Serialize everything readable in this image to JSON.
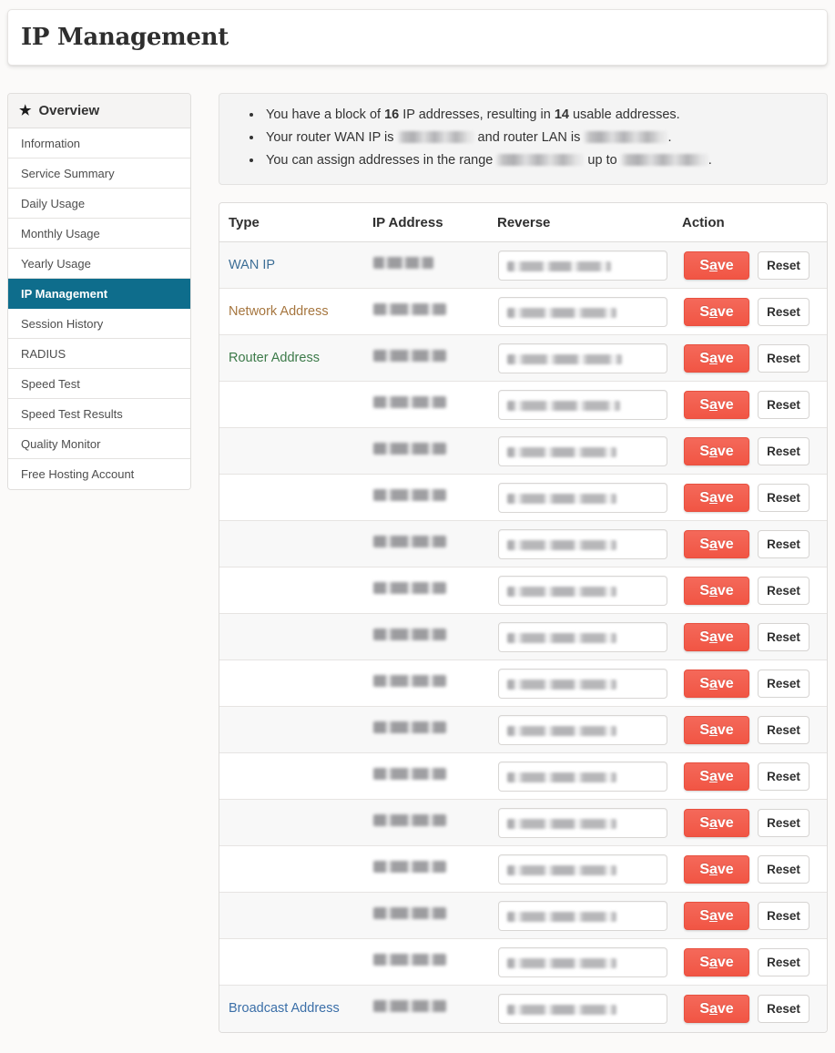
{
  "page": {
    "title": "IP Management"
  },
  "sidebar": {
    "header": {
      "label": "Overview",
      "icon": "star-icon"
    },
    "items": [
      {
        "label": "Information",
        "active": false
      },
      {
        "label": "Service Summary",
        "active": false
      },
      {
        "label": "Daily Usage",
        "active": false
      },
      {
        "label": "Monthly Usage",
        "active": false
      },
      {
        "label": "Yearly Usage",
        "active": false
      },
      {
        "label": "IP Management",
        "active": true
      },
      {
        "label": "Session History",
        "active": false
      },
      {
        "label": "RADIUS",
        "active": false
      },
      {
        "label": "Speed Test",
        "active": false
      },
      {
        "label": "Speed Test Results",
        "active": false
      },
      {
        "label": "Quality Monitor",
        "active": false
      },
      {
        "label": "Free Hosting Account",
        "active": false
      }
    ]
  },
  "info_panel": {
    "bullets": [
      {
        "parts": [
          {
            "type": "text",
            "value": "You have a block of "
          },
          {
            "type": "strong",
            "value": "16"
          },
          {
            "type": "text",
            "value": " IP addresses, resulting in "
          },
          {
            "type": "strong",
            "value": "14"
          },
          {
            "type": "text",
            "value": " usable addresses."
          }
        ]
      },
      {
        "parts": [
          {
            "type": "text",
            "value": "Your router WAN IP is "
          },
          {
            "type": "redacted",
            "value": "",
            "style": "r-wan"
          },
          {
            "type": "text",
            "value": " and router LAN is "
          },
          {
            "type": "redacted",
            "value": "",
            "style": "r-lan"
          },
          {
            "type": "text",
            "value": "."
          }
        ]
      },
      {
        "parts": [
          {
            "type": "text",
            "value": "You can assign addresses in the range "
          },
          {
            "type": "redacted",
            "value": "",
            "style": "r-from"
          },
          {
            "type": "text",
            "value": " up to "
          },
          {
            "type": "redacted",
            "value": "",
            "style": "r-to"
          },
          {
            "type": "text",
            "value": "."
          }
        ]
      }
    ]
  },
  "table": {
    "columns": [
      "Type",
      "IP Address",
      "Reverse",
      "Action"
    ],
    "save_label_pre": "S",
    "save_label_key": "a",
    "save_label_post": "ve",
    "reset_label": "Reset",
    "rows": [
      {
        "type": "WAN IP",
        "type_style": "t-wan",
        "ip_width": 66,
        "rev_width": 114
      },
      {
        "type": "Network Address",
        "type_style": "t-network",
        "ip_width": 80,
        "rev_width": 120
      },
      {
        "type": "Router Address",
        "type_style": "t-router",
        "ip_width": 80,
        "rev_width": 126
      },
      {
        "type": "",
        "type_style": "",
        "ip_width": 80,
        "rev_width": 124
      },
      {
        "type": "",
        "type_style": "",
        "ip_width": 80,
        "rev_width": 120
      },
      {
        "type": "",
        "type_style": "",
        "ip_width": 80,
        "rev_width": 120
      },
      {
        "type": "",
        "type_style": "",
        "ip_width": 80,
        "rev_width": 120
      },
      {
        "type": "",
        "type_style": "",
        "ip_width": 80,
        "rev_width": 120
      },
      {
        "type": "",
        "type_style": "",
        "ip_width": 80,
        "rev_width": 120
      },
      {
        "type": "",
        "type_style": "",
        "ip_width": 80,
        "rev_width": 120
      },
      {
        "type": "",
        "type_style": "",
        "ip_width": 80,
        "rev_width": 120
      },
      {
        "type": "",
        "type_style": "",
        "ip_width": 80,
        "rev_width": 120
      },
      {
        "type": "",
        "type_style": "",
        "ip_width": 80,
        "rev_width": 120
      },
      {
        "type": "",
        "type_style": "",
        "ip_width": 80,
        "rev_width": 120
      },
      {
        "type": "",
        "type_style": "",
        "ip_width": 80,
        "rev_width": 120
      },
      {
        "type": "",
        "type_style": "",
        "ip_width": 80,
        "rev_width": 120
      },
      {
        "type": "Broadcast Address",
        "type_style": "t-broadcast",
        "ip_width": 80,
        "rev_width": 120
      }
    ]
  },
  "colors": {
    "accent_active": "#0e6d8c",
    "save_button": "#f15544",
    "page_background": "#fbfaf9",
    "info_panel_background": "#f4f4f4",
    "row_stripe": "#f8f8f8"
  }
}
